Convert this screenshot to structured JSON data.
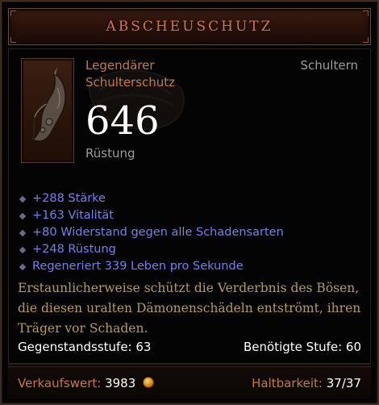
{
  "item": {
    "name": "ABSCHEUSCHUTZ",
    "rarity_line": "Legendärer",
    "type_line": "Schulterschutz",
    "slot": "Schultern",
    "armor_value": "646",
    "armor_label": "Rüstung",
    "icon": "shoulder-armor-icon"
  },
  "affixes": [
    "+288 Stärke",
    "+163 Vitalität",
    "+80 Widerstand gegen alle Schadensarten",
    "+248 Rüstung",
    "Regeneriert 339 Leben pro Sekunde"
  ],
  "flavor": {
    "lines": [
      "Erstaunlicherweise schützt die Verderbnis des Bösen,",
      "die diesen uralten Dämonenschädeln entströmt, ihren",
      "Träger vor Schaden."
    ]
  },
  "requirements": {
    "item_level": "Gegenstandsstufe: 63",
    "required_level": "Benötigte Stufe: 60"
  },
  "footer": {
    "sell_label": "Verkaufswert:",
    "sell_value": "3983",
    "durability_label": "Haltbarkeit:",
    "durability_value": "37/37"
  },
  "colors": {
    "legendary": "#c17a45",
    "title": "#d0744a",
    "magic_affix": "#7a7cf0",
    "flavor": "#b39c56",
    "gray": "#9d9b99"
  }
}
